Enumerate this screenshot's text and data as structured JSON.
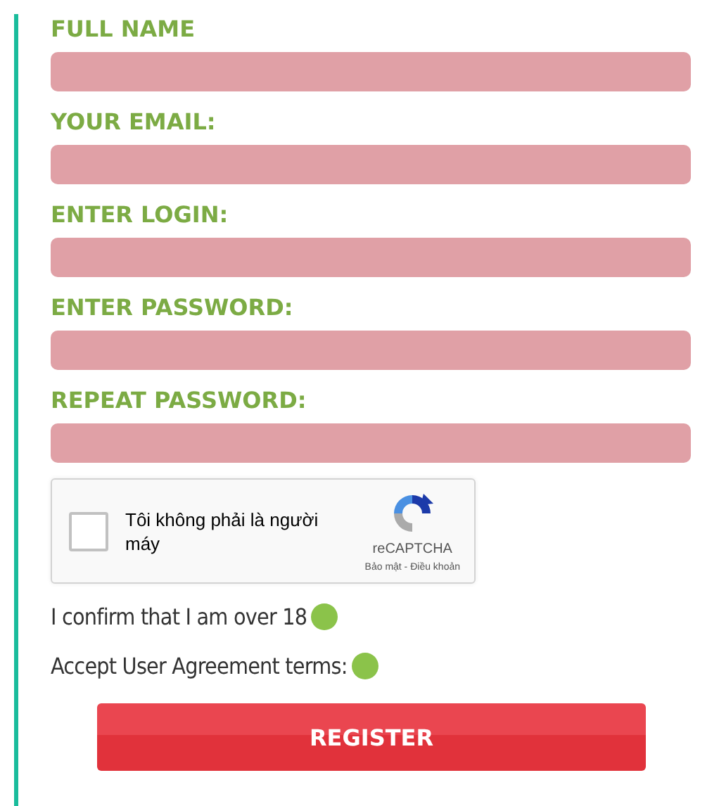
{
  "fields": [
    {
      "label": "FULL NAME"
    },
    {
      "label": "YOUR EMAIL:"
    },
    {
      "label": "ENTER LOGIN:"
    },
    {
      "label": "ENTER PASSWORD:"
    },
    {
      "label": "REPEAT PASSWORD:"
    }
  ],
  "captcha": {
    "checked": false,
    "text": "Tôi không phải là người máy",
    "brand": "reCAPTCHA",
    "links": "Bảo mật - Điều khoản"
  },
  "confirmations": [
    {
      "label": "I confirm that I am over 18",
      "checked": true
    },
    {
      "label": "Accept User Agreement terms:",
      "checked": true
    }
  ],
  "submit": "REGISTER"
}
